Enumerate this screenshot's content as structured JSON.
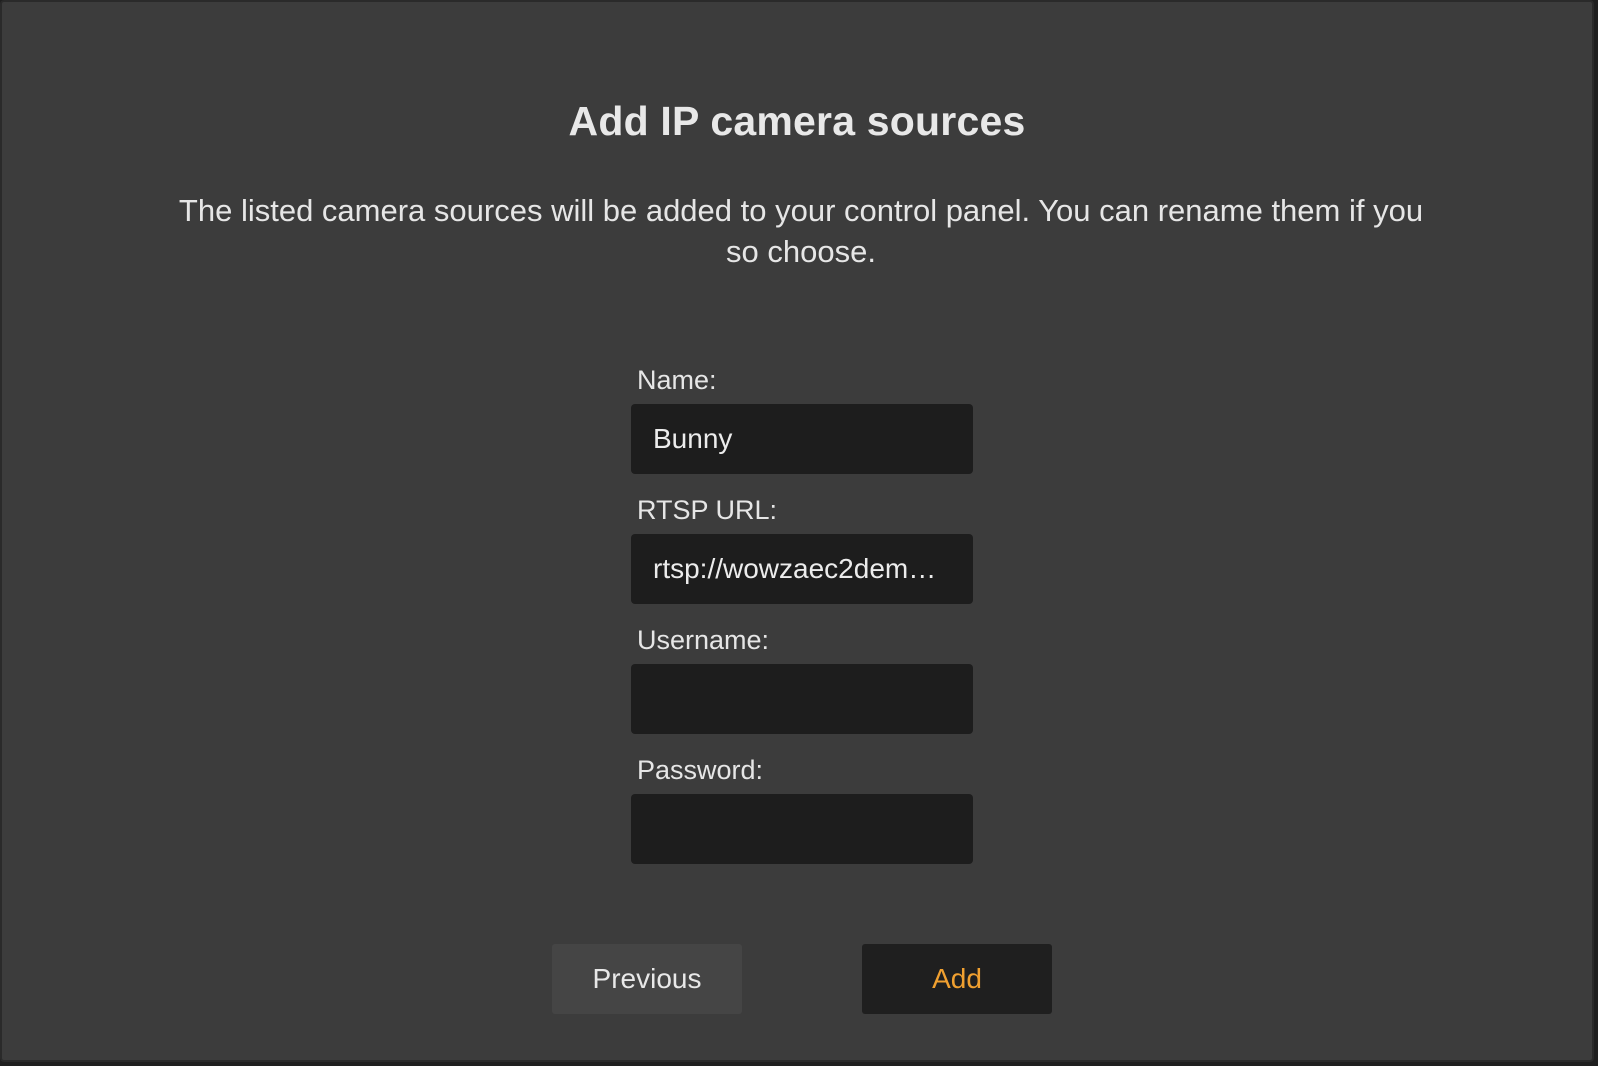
{
  "dialog": {
    "title": "Add IP camera sources",
    "description": "The listed camera sources will be added to your control panel. You can rename them if you so choose."
  },
  "form": {
    "name": {
      "label": "Name:",
      "value": "Bunny"
    },
    "rtsp_url": {
      "label": "RTSP URL:",
      "value": "rtsp://wowzaec2dem…"
    },
    "username": {
      "label": "Username:",
      "value": ""
    },
    "password": {
      "label": "Password:",
      "value": ""
    }
  },
  "buttons": {
    "previous_label": "Previous",
    "add_label": "Add"
  },
  "colors": {
    "background": "#3c3c3c",
    "input_background": "#1d1d1d",
    "accent": "#f0a030"
  }
}
